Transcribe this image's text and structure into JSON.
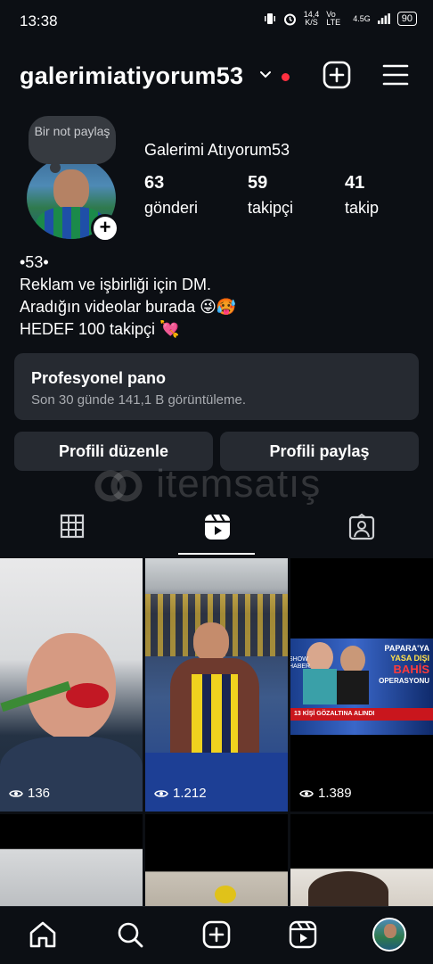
{
  "status_bar": {
    "time": "13:38",
    "speed": "14,4",
    "speed_unit": "K/S",
    "network": "Vo LTE",
    "signal": "4.5G",
    "battery": "90"
  },
  "header": {
    "username": "galerimiatiyorum53",
    "has_notification_dot": true,
    "chevron_icon": "chevron-down-icon",
    "add_icon": "plus-square-icon",
    "menu_icon": "hamburger-menu-icon"
  },
  "profile": {
    "note_text": "Bir not paylaş",
    "display_name": "Galerimi Atıyorum53",
    "stats": [
      {
        "value": "63",
        "label": "gönderi"
      },
      {
        "value": "59",
        "label": "takipçi"
      },
      {
        "value": "41",
        "label": "takip"
      }
    ],
    "bio": [
      "•53•",
      "Reklam ve işbirliği için DM.",
      "Aradığın videolar burada 😜🥵",
      "HEDEF 100 takipçi 💘"
    ]
  },
  "dashboard": {
    "title": "Profesyonel pano",
    "subtitle": "Son 30 günde 141,1 B görüntüleme."
  },
  "buttons": {
    "edit": "Profili düzenle",
    "share": "Profili paylaş"
  },
  "watermark": "itemsatış",
  "tabs": [
    {
      "name": "grid",
      "icon": "grid-icon",
      "active": false
    },
    {
      "name": "reels",
      "icon": "reels-icon",
      "active": true
    },
    {
      "name": "tagged",
      "icon": "tagged-person-icon",
      "active": false
    }
  ],
  "posts": [
    {
      "views": "136"
    },
    {
      "views": "1.212"
    },
    {
      "views": "1.389"
    }
  ],
  "post3_overlay": {
    "headline_1": "PAPARA'YA",
    "headline_2": "YASA DIŞI",
    "headline_3": "BAHİS",
    "headline_4": "OPERASYONU",
    "ticker": "13 KİŞİ GÖZALTINA ALINDI",
    "side_label": "SHOW HABER"
  },
  "bottom_nav": [
    {
      "icon": "home-icon"
    },
    {
      "icon": "search-icon"
    },
    {
      "icon": "create-icon"
    },
    {
      "icon": "reels-icon"
    },
    {
      "icon": "profile-avatar-icon"
    }
  ]
}
